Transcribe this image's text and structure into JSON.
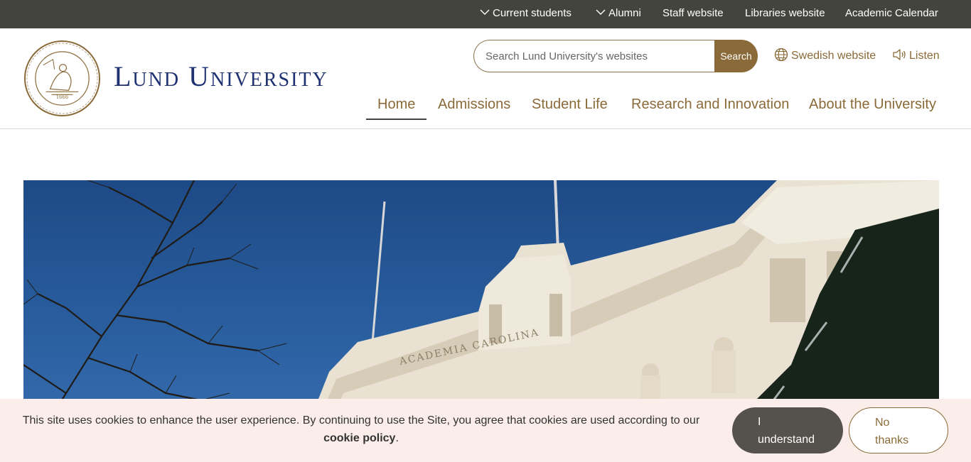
{
  "topbar": {
    "current_students": "Current students",
    "alumni": "Alumni",
    "staff": "Staff website",
    "libraries": "Libraries website",
    "calendar": "Academic Calendar"
  },
  "brand": {
    "name": "Lund University",
    "seal_year": "1666"
  },
  "search": {
    "placeholder": "Search Lund University's websites",
    "button": "Search"
  },
  "utility": {
    "swedish": "Swedish website",
    "listen": "Listen"
  },
  "nav": {
    "items": [
      "Home",
      "Admissions",
      "Student Life",
      "Research and Innovation",
      "About the University"
    ],
    "active": "Home"
  },
  "hero": {
    "inscription": "ACADEMIA CAROLINA"
  },
  "cookie": {
    "text": "This site uses cookies to enhance the user experience. By continuing to use the Site, you agree that cookies are used according to our",
    "link": "cookie policy",
    "period": ".",
    "accept_line1": "I",
    "accept_line2": "understand",
    "decline_line1": "No",
    "decline_line2": "thanks"
  },
  "colors": {
    "topbar_bg": "#44443f",
    "accent_bronze": "#8a6a38",
    "brand_navy": "#1e3170",
    "cookie_bg": "#fbeeea"
  }
}
